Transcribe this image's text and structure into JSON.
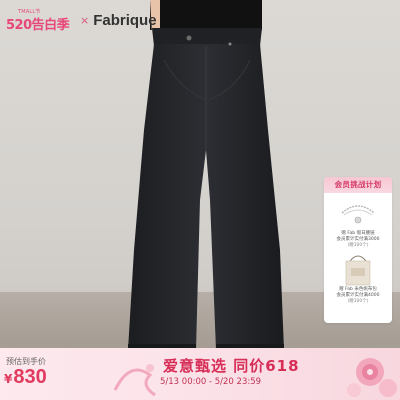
{
  "brand": {
    "promo_mini": "TMALL节",
    "promo_main": "520告白季",
    "times": "×",
    "name": "Fabrique"
  },
  "card": {
    "header": "会员挑战计划",
    "item1_line1": "赠 Fab 假日腰链",
    "item1_line2": "会员累计实付满3000",
    "item1_line3": "(赠100个)",
    "item2_line1": "赠 Fab 米色帆布包",
    "item2_line2": "会员累计实付满4000",
    "item2_line3": "(赠100个)"
  },
  "bottom": {
    "presale_label": "预估到手价",
    "currency": "¥",
    "price": "830",
    "slogan": "爱意甄选 同价618",
    "date_range": "5/13 00:00 - 5/20 23:59"
  },
  "colors": {
    "accent": "#e23a5f",
    "jeans": "#222428",
    "background": "#d8d5d1"
  }
}
